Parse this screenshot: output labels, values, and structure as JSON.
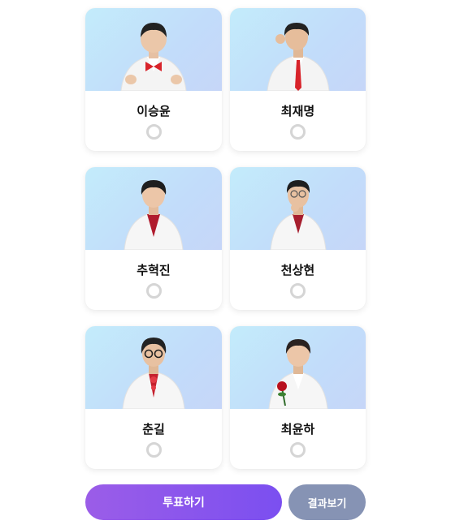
{
  "candidates": [
    {
      "name": "이승윤",
      "tie": "bowtie",
      "tie_color": "#d8232a"
    },
    {
      "name": "최재명",
      "tie": "tie",
      "tie_color": "#d8232a"
    },
    {
      "name": "추혁진",
      "tie": "shirt",
      "tie_color": "#b01c2e"
    },
    {
      "name": "천상현",
      "tie": "shirt",
      "tie_color": "#a61e2e"
    },
    {
      "name": "춘길",
      "tie": "ornament",
      "tie_color": "#c4202d"
    },
    {
      "name": "최윤하",
      "tie": "rose",
      "tie_color": "#c4202d"
    }
  ],
  "actions": {
    "vote_label": "투표하기",
    "result_label": "결과보기"
  },
  "colors": {
    "vote_button": "#8a55ec",
    "result_button": "#8693b4",
    "radio_border": "#d5d5d5"
  }
}
